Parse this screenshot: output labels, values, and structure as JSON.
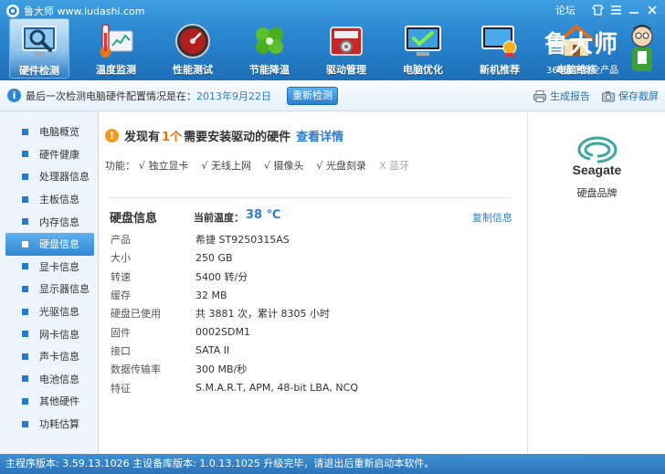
{
  "app": {
    "title": "鲁大师 www.ludashi.com",
    "forum_link": "论坛"
  },
  "toolbar": [
    {
      "label": "硬件检测",
      "icon": "magnifier-monitor-icon",
      "active": true
    },
    {
      "label": "温度监测",
      "icon": "thermometer-icon"
    },
    {
      "label": "性能测试",
      "icon": "speedometer-icon"
    },
    {
      "label": "节能降温",
      "icon": "clover-icon"
    },
    {
      "label": "驱动管理",
      "icon": "gear-box-icon"
    },
    {
      "label": "电脑优化",
      "icon": "monitor-check-icon"
    },
    {
      "label": "新机推荐",
      "icon": "monitor-award-icon"
    },
    {
      "label": "电脑维修",
      "icon": "house-icon"
    }
  ],
  "brand": {
    "title": "鲁大师",
    "subtitle": "360旗下安全产品"
  },
  "infobar": {
    "text": "最后一次检测电脑硬件配置情况是在：",
    "date": "2013年9月22日",
    "recheck_button": "重新检测",
    "report_button": "生成报告",
    "screenshot_button": "保存截屏"
  },
  "sidebar": [
    {
      "label": "电脑概览"
    },
    {
      "label": "硬件健康"
    },
    {
      "label": "处理器信息"
    },
    {
      "label": "主板信息"
    },
    {
      "label": "内存信息"
    },
    {
      "label": "硬盘信息",
      "active": true
    },
    {
      "label": "显卡信息"
    },
    {
      "label": "显示器信息"
    },
    {
      "label": "光驱信息"
    },
    {
      "label": "网卡信息"
    },
    {
      "label": "声卡信息"
    },
    {
      "label": "电池信息"
    },
    {
      "label": "其他硬件"
    },
    {
      "label": "功耗估算"
    }
  ],
  "warning": {
    "prefix": "发现有",
    "count": "1个",
    "suffix": "需要安装驱动的硬件",
    "link": "查看详情"
  },
  "functions": {
    "label": "功能：",
    "items": [
      {
        "text": "√ 独立显卡",
        "enabled": true
      },
      {
        "text": "√ 无线上网",
        "enabled": true
      },
      {
        "text": "√ 摄像头",
        "enabled": true
      },
      {
        "text": "√ 光盘刻录",
        "enabled": true
      },
      {
        "text": "X 蓝牙",
        "enabled": false
      }
    ]
  },
  "disk": {
    "section_title": "硬盘信息",
    "temp_label": "当前温度：",
    "temp_value": "38 ℃",
    "copy_link": "复制信息",
    "specs": [
      {
        "key": "产品",
        "value": "希捷 ST9250315AS"
      },
      {
        "key": "大小",
        "value": "250 GB"
      },
      {
        "key": "转速",
        "value": "5400 转/分"
      },
      {
        "key": "缓存",
        "value": "32 MB"
      },
      {
        "key": "硬盘已使用",
        "value": "共 3881 次，累计 8305 小时"
      },
      {
        "key": "固件",
        "value": "0002SDM1"
      },
      {
        "key": "接口",
        "value": "SATA II"
      },
      {
        "key": "数据传输率",
        "value": "300 MB/秒"
      },
      {
        "key": "特征",
        "value": "S.M.A.R.T,  APM,  48-bit LBA,  NCQ"
      }
    ]
  },
  "brand_panel": {
    "logo_text": "Seagate",
    "caption": "硬盘品牌"
  },
  "statusbar": {
    "text": "主程序版本: 3.59.13.1026  主设备库版本: 1.0.13.1025   升级完毕，请退出后重新启动本软件。"
  },
  "colors": {
    "header_blue": "#2a86cf",
    "link_blue": "#2a7dd0",
    "warning_orange": "#e4700f"
  }
}
